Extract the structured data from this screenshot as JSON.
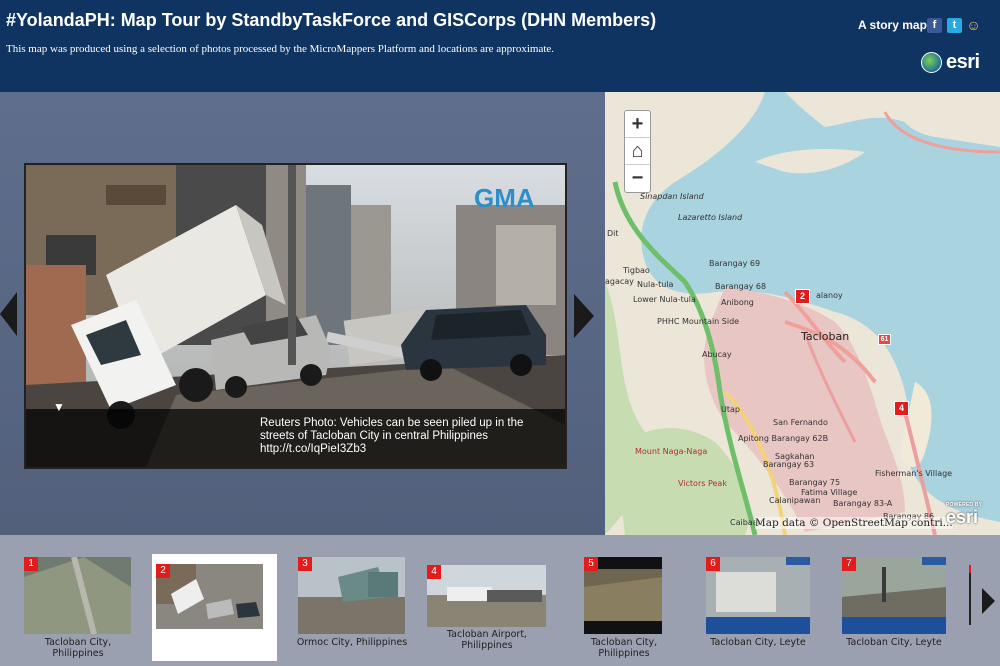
{
  "header": {
    "title": "#YolandaPH: Map Tour by StandbyTaskForce and GISCorps (DHN Members)",
    "subtitle": "This map was produced using a selection of photos processed by the MicroMappers Platform and locations are approximate.",
    "story_map_label": "A story map",
    "facebook_glyph": "f",
    "twitter_glyph": "t",
    "share_glyph": "☺",
    "brand": "esri"
  },
  "media": {
    "caption": "Reuters Photo: Vehicles can be seen piled up in the streets of Tacloban City in central Philippines http://t.co/IqPieI3Zb3",
    "caption_toggle": "▼",
    "watermark": "GMA"
  },
  "map": {
    "zoom_in": "+",
    "home": "⌂",
    "zoom_out": "−",
    "labels": {
      "sinapdan": "Sinapdan Island",
      "lazaretto": "Lazaretto Island",
      "dit": "Dit",
      "tigbao": "Tigbao",
      "agacay": "agacay",
      "nulatula": "Nula-tula",
      "lower_nulatula": "Lower Nula-tula",
      "barangay69": "Barangay 69",
      "barangay68": "Barangay 68",
      "anibong": "Anibong",
      "palanoy": "alanoy",
      "phhc": "PHHC Mountain Side",
      "tacloban": "Tacloban",
      "abucay": "Abucay",
      "utap": "Utap",
      "san_fernando": "San Fernando",
      "apitong": "Apitong Barangay 62B",
      "barangay63": "Barangay 63",
      "sagkahan": "Sagkahan",
      "mount_naga": "Mount Naga-Naga",
      "victors_peak": "Victors Peak",
      "barangay75": "Barangay 75",
      "fatima": "Fatima Village",
      "barangay83a": "Barangay 83-A",
      "calanipawan": "Calanipawan",
      "barangay86": "Barangay 86",
      "caibaan": "Caibaan",
      "fishermans": "Fisherman's Village"
    },
    "markers": {
      "m2": "2",
      "m61": "61",
      "m4": "4"
    },
    "attribution": "Map data © OpenStreetMap contri...",
    "powered_by": "POWERED BY",
    "esri_badge": "esri"
  },
  "thumbnails": [
    {
      "num": "1",
      "label": "Tacloban City, Philippines"
    },
    {
      "num": "2",
      "label": ""
    },
    {
      "num": "3",
      "label": "Ormoc City, Philippines"
    },
    {
      "num": "4",
      "label": "Tacloban Airport, Philippines"
    },
    {
      "num": "5",
      "label": "Tacloban City, Philippines"
    },
    {
      "num": "6",
      "label": "Tacloban City, Leyte"
    },
    {
      "num": "7",
      "label": "Tacloban City, Leyte"
    }
  ],
  "colors": {
    "header_bg": "#0f3461",
    "marker_red": "#e21c1c",
    "water": "#a9d3df"
  }
}
